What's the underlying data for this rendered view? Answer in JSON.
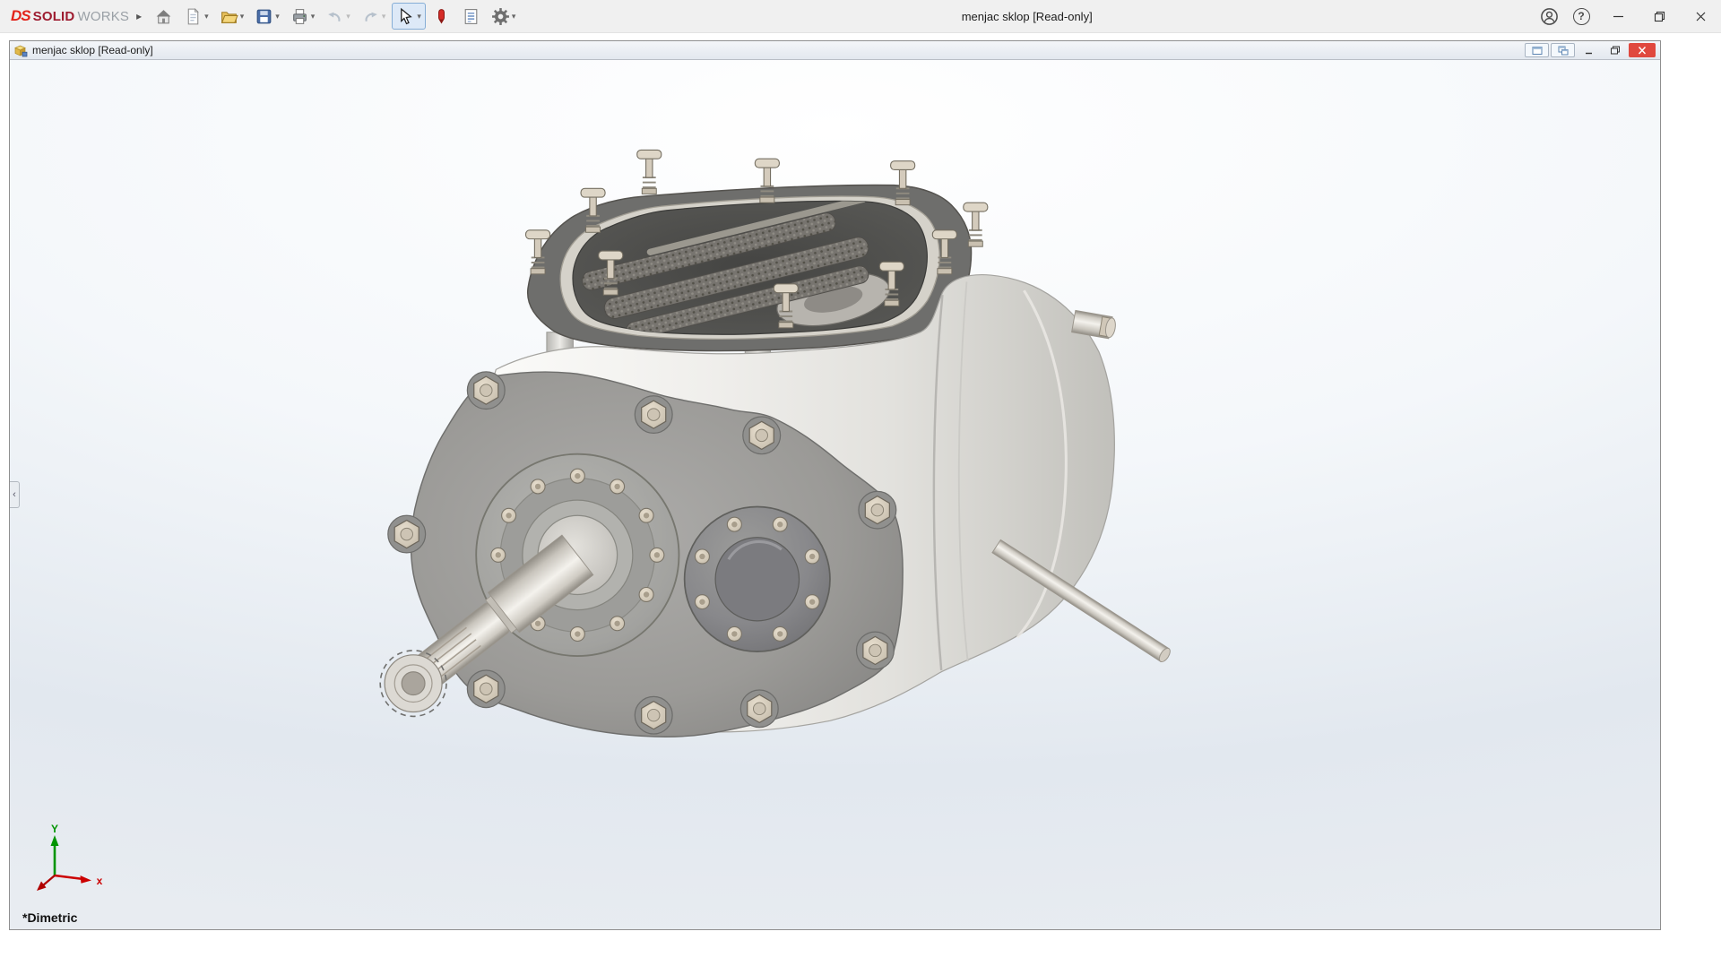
{
  "app": {
    "brand": {
      "logo": "DS",
      "name_bold": "SOLID",
      "name_light": "WORKS"
    },
    "title": "menjac sklop [Read-only]",
    "help_glyph": "?"
  },
  "glyphs": {
    "dropdown": "▾",
    "expand_right": "▸",
    "panel_collapse": "‹"
  },
  "doc": {
    "title": "menjac sklop [Read-only]"
  },
  "viewport": {
    "view_name": "*Dimetric",
    "axis_x_label": "x",
    "axis_y_label": "Y"
  },
  "toolbar_items": [
    {
      "icon": "home",
      "dropdown": false,
      "disabled": false
    },
    {
      "icon": "new-document",
      "dropdown": true,
      "disabled": false
    },
    {
      "icon": "open",
      "dropdown": true,
      "disabled": false
    },
    {
      "icon": "save",
      "dropdown": true,
      "disabled": false
    },
    {
      "icon": "print",
      "dropdown": true,
      "disabled": false
    },
    {
      "icon": "undo",
      "dropdown": true,
      "disabled": true
    },
    {
      "icon": "redo",
      "dropdown": true,
      "disabled": true
    },
    {
      "icon": "select-cursor",
      "dropdown": true,
      "disabled": false,
      "active": true
    },
    {
      "icon": "pen",
      "dropdown": false,
      "disabled": false
    },
    {
      "icon": "file-properties",
      "dropdown": false,
      "disabled": false
    },
    {
      "icon": "options-gear",
      "dropdown": true,
      "disabled": false
    }
  ],
  "colors": {
    "brand_red": "#e2231a",
    "doc_close_red": "#e0483e",
    "axis_x_red": "#cc0000",
    "axis_y_green": "#009400",
    "viewport_top": "#ffffff",
    "viewport_bottom": "#e2e8ef"
  }
}
